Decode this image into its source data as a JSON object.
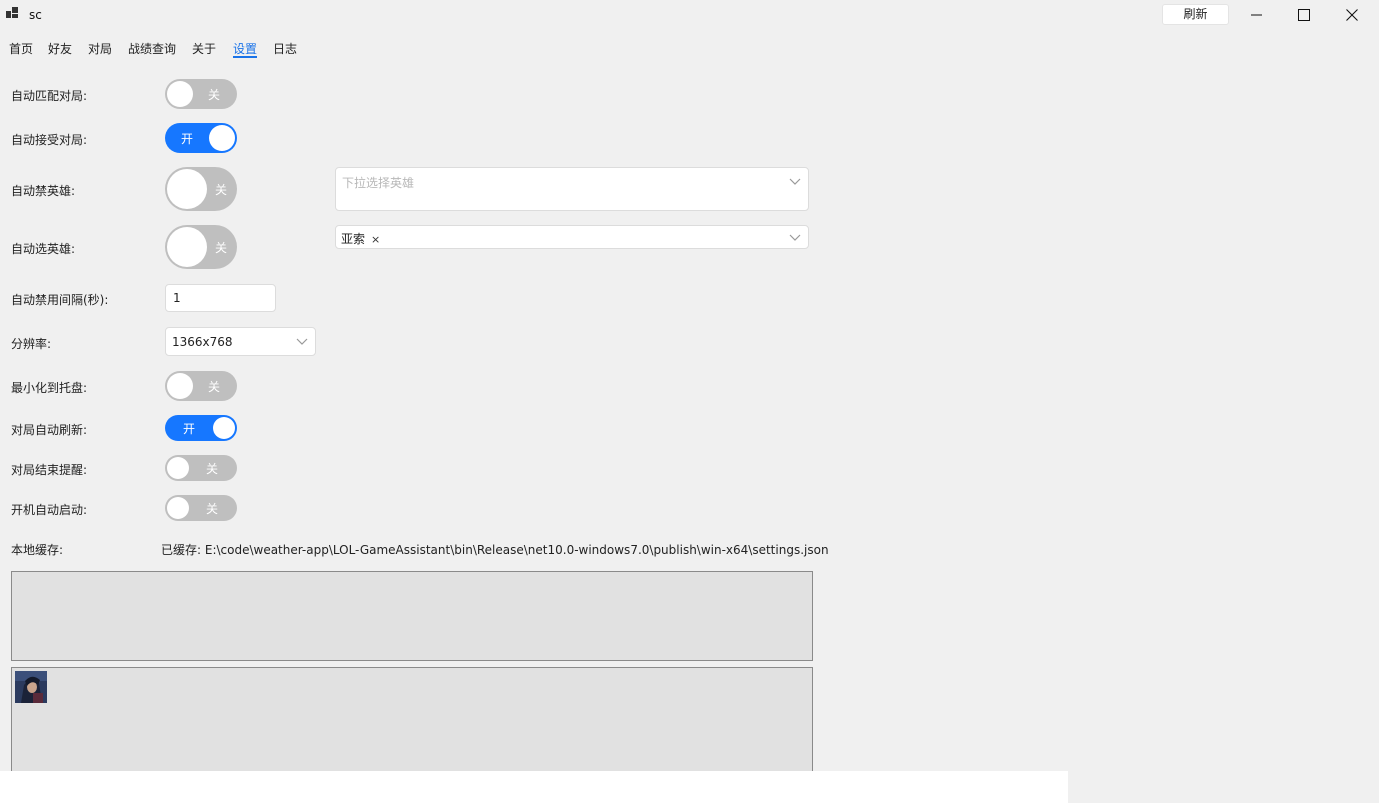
{
  "window": {
    "title": "sc",
    "refresh_label": "刷新"
  },
  "tabs": [
    {
      "label": "首页"
    },
    {
      "label": "好友"
    },
    {
      "label": "对局"
    },
    {
      "label": "战绩查询"
    },
    {
      "label": "关于"
    },
    {
      "label": "设置",
      "active": true
    },
    {
      "label": "日志"
    }
  ],
  "settings": {
    "auto_match": {
      "label": "自动匹配对局:",
      "on": false,
      "state_text": "关"
    },
    "auto_accept": {
      "label": "自动接受对局:",
      "on": true,
      "state_text": "开"
    },
    "auto_ban": {
      "label": "自动禁英雄:",
      "on": false,
      "state_text": "关",
      "select_placeholder": "下拉选择英雄"
    },
    "auto_pick": {
      "label": "自动选英雄:",
      "on": false,
      "state_text": "关",
      "selected_tag": "亚索",
      "tag_remove": "×"
    },
    "ban_interval": {
      "label": "自动禁用间隔(秒):",
      "value": "1"
    },
    "resolution": {
      "label": "分辨率:",
      "value": "1366x768"
    },
    "minimize_tray": {
      "label": "最小化到托盘:",
      "on": false,
      "state_text": "关"
    },
    "auto_refresh": {
      "label": "对局自动刷新:",
      "on": true,
      "state_text": "开"
    },
    "end_reminder": {
      "label": "对局结束提醒:",
      "on": false,
      "state_text": "关"
    },
    "startup": {
      "label": "开机自动启动:",
      "on": false,
      "state_text": "关"
    },
    "cache": {
      "label": "本地缓存:",
      "value": "已缓存: E:\\code\\weather-app\\LOL-GameAssistant\\bin\\Release\\net10.0-windows7.0\\publish\\win-x64\\settings.json"
    }
  },
  "icons": {
    "app": "app-icon",
    "minimize": "minimize-icon",
    "maximize": "maximize-icon",
    "close": "close-icon",
    "chevron": "chevron-down-icon",
    "champion": "champion-avatar-icon"
  },
  "colors": {
    "accent": "#1677ff",
    "toggle_off": "#bfbfbf",
    "panel_bg": "#e1e1e1"
  }
}
